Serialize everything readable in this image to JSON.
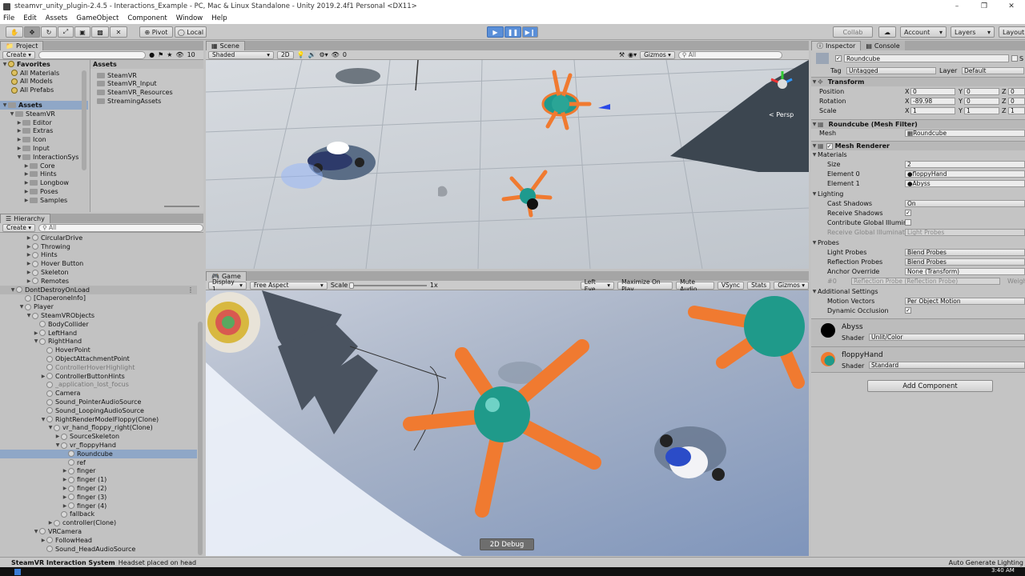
{
  "window": {
    "title": "steamvr_unity_plugin-2.4.5 - Interactions_Example - PC, Mac & Linux Standalone - Unity 2019.2.4f1 Personal <DX11>"
  },
  "menu": [
    "File",
    "Edit",
    "Assets",
    "GameObject",
    "Component",
    "Window",
    "Help"
  ],
  "toolbar": {
    "pivot": "Pivot",
    "local": "Local",
    "collab": "Collab",
    "account": "Account",
    "layers": "Layers",
    "layout": "Layout"
  },
  "project": {
    "tab_project": "Project",
    "tab_create": "Create",
    "badge": "10",
    "favorites_label": "Favorites",
    "favorites": [
      "All Materials",
      "All Models",
      "All Prefabs"
    ],
    "assets_root": "Assets",
    "tree": [
      {
        "label": "SteamVR",
        "depth": 1
      },
      {
        "label": "Editor",
        "depth": 2
      },
      {
        "label": "Extras",
        "depth": 2
      },
      {
        "label": "Icon",
        "depth": 2
      },
      {
        "label": "Input",
        "depth": 2
      },
      {
        "label": "InteractionSys",
        "depth": 2
      },
      {
        "label": "Core",
        "depth": 3
      },
      {
        "label": "Hints",
        "depth": 3
      },
      {
        "label": "Longbow",
        "depth": 3
      },
      {
        "label": "Poses",
        "depth": 3
      },
      {
        "label": "Samples",
        "depth": 3
      }
    ],
    "right_header": "Assets",
    "right_items": [
      "SteamVR",
      "SteamVR_Input",
      "SteamVR_Resources",
      "StreamingAssets"
    ]
  },
  "hierarchy": {
    "tab": "Hierarchy",
    "create": "Create",
    "search": "All",
    "items": [
      {
        "label": "CircularDrive",
        "depth": 2,
        "style": "normal"
      },
      {
        "label": "Throwing",
        "depth": 2,
        "style": "normal"
      },
      {
        "label": "Hints",
        "depth": 2,
        "style": "normal"
      },
      {
        "label": "Hover Button",
        "depth": 2,
        "style": "normal"
      },
      {
        "label": "Skeleton",
        "depth": 2,
        "style": "normal"
      },
      {
        "label": "Remotes",
        "depth": 2,
        "style": "normal"
      },
      {
        "label": "DontDestroyOnLoad",
        "depth": 0,
        "style": "scene"
      },
      {
        "label": "[ChaperoneInfo]",
        "depth": 1,
        "style": "normal"
      },
      {
        "label": "Player",
        "depth": 1,
        "style": "normal"
      },
      {
        "label": "SteamVRObjects",
        "depth": 2,
        "style": "normal"
      },
      {
        "label": "BodyCollider",
        "depth": 3,
        "style": "normal"
      },
      {
        "label": "LeftHand",
        "depth": 3,
        "style": "normal"
      },
      {
        "label": "RightHand",
        "depth": 3,
        "style": "normal"
      },
      {
        "label": "HoverPoint",
        "depth": 4,
        "style": "normal"
      },
      {
        "label": "ObjectAttachmentPoint",
        "depth": 4,
        "style": "normal"
      },
      {
        "label": "ControllerHoverHighlight",
        "depth": 4,
        "style": "gray"
      },
      {
        "label": "ControllerButtonHints",
        "depth": 4,
        "style": "normal"
      },
      {
        "label": "_application_lost_focus",
        "depth": 4,
        "style": "gray"
      },
      {
        "label": "Camera",
        "depth": 4,
        "style": "normal"
      },
      {
        "label": "Sound_PointerAudioSource",
        "depth": 4,
        "style": "normal"
      },
      {
        "label": "Sound_LoopingAudioSource",
        "depth": 4,
        "style": "normal"
      },
      {
        "label": "RightRenderModelFloppy(Clone)",
        "depth": 4,
        "style": "normal"
      },
      {
        "label": "vr_hand_floppy_right(Clone)",
        "depth": 5,
        "style": "normal"
      },
      {
        "label": "SourceSkeleton",
        "depth": 6,
        "style": "normal"
      },
      {
        "label": "vr_floppyHand",
        "depth": 6,
        "style": "normal"
      },
      {
        "label": "Roundcube",
        "depth": 7,
        "style": "selected"
      },
      {
        "label": "ref",
        "depth": 7,
        "style": "normal"
      },
      {
        "label": "finger",
        "depth": 7,
        "style": "normal"
      },
      {
        "label": "finger (1)",
        "depth": 7,
        "style": "normal"
      },
      {
        "label": "finger (2)",
        "depth": 7,
        "style": "normal"
      },
      {
        "label": "finger (3)",
        "depth": 7,
        "style": "normal"
      },
      {
        "label": "finger (4)",
        "depth": 7,
        "style": "normal"
      },
      {
        "label": "fallback",
        "depth": 6,
        "style": "normal"
      },
      {
        "label": "controller(Clone)",
        "depth": 5,
        "style": "normal"
      },
      {
        "label": "VRCamera",
        "depth": 3,
        "style": "normal"
      },
      {
        "label": "FollowHead",
        "depth": 4,
        "style": "normal"
      },
      {
        "label": "Sound_HeadAudioSource",
        "depth": 4,
        "style": "normal"
      }
    ]
  },
  "scene": {
    "tab": "Scene",
    "shading": "Shaded",
    "mode_2d": "2D",
    "fx_count": "0",
    "gizmos": "Gizmos",
    "search": "All",
    "persp": "< Persp"
  },
  "game": {
    "tab": "Game",
    "display": "Display 1",
    "aspect": "Free Aspect",
    "scale_label": "Scale",
    "scale_value": "1x",
    "buttons": [
      "Left Eye",
      "Maximize On Play",
      "Mute Audio",
      "VSync",
      "Stats",
      "Gizmos"
    ],
    "debug_button": "2D Debug"
  },
  "inspector": {
    "tab_inspector": "Inspector",
    "tab_console": "Console",
    "object_name": "Roundcube",
    "static_label": "S",
    "tag_label": "Tag",
    "tag": "Untagged",
    "layer_label": "Layer",
    "layer": "Default",
    "transform": {
      "title": "Transform",
      "position": {
        "label": "Position",
        "x": "0",
        "y": "0",
        "z": "0"
      },
      "rotation": {
        "label": "Rotation",
        "x": "-89.98",
        "y": "0",
        "z": "0"
      },
      "scale": {
        "label": "Scale",
        "x": "1",
        "y": "1",
        "z": "1"
      }
    },
    "mesh_filter": {
      "title": "Roundcube (Mesh Filter)",
      "mesh_label": "Mesh",
      "mesh": "Roundcube"
    },
    "mesh_renderer": {
      "title": "Mesh Renderer",
      "materials": "Materials",
      "size_label": "Size",
      "size": "2",
      "element0_label": "Element 0",
      "element0": "floppyHand",
      "element1_label": "Element 1",
      "element1": "Abyss",
      "lighting": "Lighting",
      "cast_shadows_label": "Cast Shadows",
      "cast_shadows": "On",
      "receive_shadows_label": "Receive Shadows",
      "contribute_gi_label": "Contribute Global Illumin",
      "receive_gi_label": "Receive Global Illuminati",
      "receive_gi": "Light Probes",
      "probes": "Probes",
      "light_probes_label": "Light Probes",
      "light_probes": "Blend Probes",
      "reflection_probes_label": "Reflection Probes",
      "reflection_probes": "Blend Probes",
      "anchor_label": "Anchor Override",
      "anchor": "None (Transform)",
      "probe_row": "#0",
      "probe_row_value": "Reflection Probe (Reflection Probe)",
      "probe_row_extra": "Weigh",
      "additional": "Additional Settings",
      "motion_vectors_label": "Motion Vectors",
      "motion_vectors": "Per Object Motion",
      "dynamic_occlusion_label": "Dynamic Occlusion"
    },
    "material_abyss": {
      "name": "Abyss",
      "shader_label": "Shader",
      "shader": "Unlit/Color"
    },
    "material_floppy": {
      "name": "floppyHand",
      "shader_label": "Shader",
      "shader": "Standard"
    },
    "add_component": "Add Component"
  },
  "status": {
    "title": "SteamVR Interaction System",
    "message": "Headset placed on head",
    "right": "Auto Generate Lighting"
  },
  "taskbar": {
    "clock": "3:40 AM"
  },
  "colors": {
    "unity_bg": "#c2c2c2",
    "play_blue": "#5a8fd8",
    "selection": "#8fa7c7",
    "abyss_swatch": "#000000",
    "floppy_teal": "#1f9a8a",
    "floppy_orange": "#f07a30"
  }
}
